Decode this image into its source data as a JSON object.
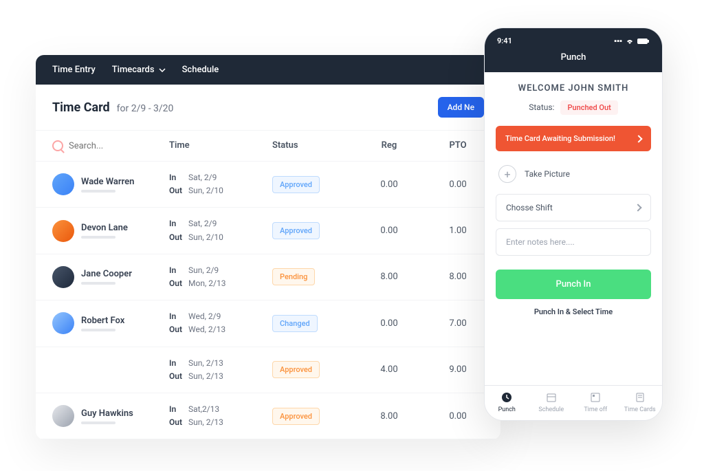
{
  "topbar": {
    "time_entry": "Time Entry",
    "timecards": "Timecards",
    "schedule": "Schedule"
  },
  "header": {
    "title": "Time Card",
    "range": "for 2/9 - 3/20",
    "add_btn": "Add Ne"
  },
  "columns": {
    "search_placeholder": "Search...",
    "time": "Time",
    "status": "Status",
    "reg": "Reg",
    "pto": "PTO"
  },
  "rows": [
    {
      "name": "Wade Warren",
      "in_lbl": "In",
      "in_date": "Sat, 2/9",
      "out_lbl": "Out",
      "out_date": "Sun, 2/10",
      "status": "Approved",
      "status_class": "status-approved",
      "reg": "0.00",
      "pto": "0.00"
    },
    {
      "name": "Devon Lane",
      "in_lbl": "In",
      "in_date": "Sat, 2/9",
      "out_lbl": "Out",
      "out_date": "Sun, 2/10",
      "status": "Approved",
      "status_class": "status-approved",
      "reg": "0.00",
      "pto": "1.00"
    },
    {
      "name": "Jane Cooper",
      "in_lbl": "In",
      "in_date": "Sun, 2/9",
      "out_lbl": "Out",
      "out_date": "Mon, 2/13",
      "status": "Pending",
      "status_class": "status-pending",
      "reg": "8.00",
      "pto": "8.00"
    },
    {
      "name": "Robert Fox",
      "in_lbl": "In",
      "in_date": "Wed, 2/9",
      "out_lbl": "Out",
      "out_date": "Wed, 2/13",
      "status": "Changed",
      "status_class": "status-changed",
      "reg": "0.00",
      "pto": "7.00"
    },
    {
      "name": "",
      "in_lbl": "In",
      "in_date": "Sun, 2/13",
      "out_lbl": "Out",
      "out_date": "Sun, 2/13",
      "status": "Approved",
      "status_class": "status-approved2",
      "reg": "4.00",
      "pto": "9.00"
    },
    {
      "name": "Guy Hawkins",
      "in_lbl": "In",
      "in_date": "Sat,2/13",
      "out_lbl": "Out",
      "out_date": "Sun, 2/13",
      "status": "Approved",
      "status_class": "status-approved2",
      "reg": "8.00",
      "pto": "0.00"
    }
  ],
  "phone": {
    "time": "9:41",
    "title": "Punch",
    "welcome": "WELCOME JOHN SMITH",
    "status_label": "Status:",
    "status_value": "Punched Out",
    "alert": "Time Card Awaiting Submission!",
    "take_picture": "Take Picture",
    "choose_shift": "Chosse Shift",
    "notes_placeholder": "Enter notes here....",
    "punch_in_btn": "Punch In",
    "punch_select": "Punch In & Select Time",
    "nav": {
      "punch": "Punch",
      "schedule": "Schedule",
      "time_off": "Time off",
      "time_cards": "Time Cards"
    }
  }
}
